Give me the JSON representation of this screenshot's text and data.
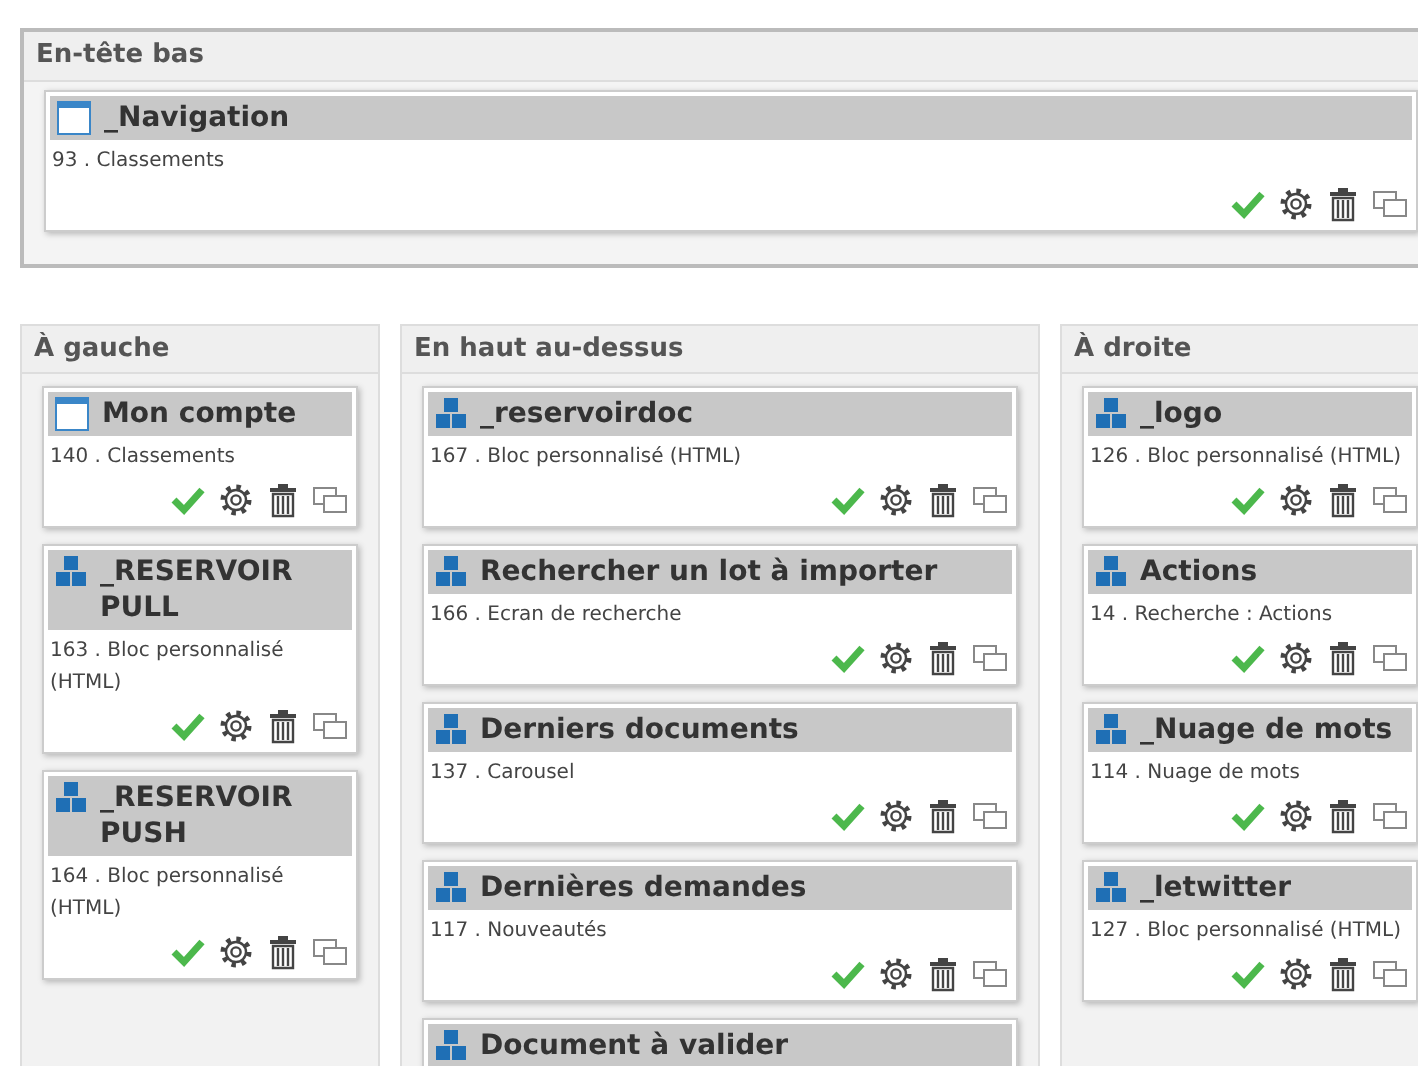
{
  "header_section": {
    "title": "En-tête bas",
    "blocks": [
      {
        "kind": "page",
        "title": "_Navigation",
        "description": "93 . Classements"
      }
    ]
  },
  "columns": [
    {
      "title": "À gauche",
      "blocks": [
        {
          "kind": "page",
          "title": "Mon compte",
          "description": "140 . Classements"
        },
        {
          "kind": "module",
          "title": "_RESERVOIR PULL",
          "description": "163 . Bloc personnalisé (HTML)"
        },
        {
          "kind": "module",
          "title": "_RESERVOIR PUSH",
          "description": "164 . Bloc personnalisé (HTML)"
        }
      ]
    },
    {
      "title": "En haut au-dessus",
      "blocks": [
        {
          "kind": "module",
          "title": "_reservoirdoc",
          "description": "167 . Bloc personnalisé (HTML)"
        },
        {
          "kind": "module",
          "title": "Rechercher un lot à importer",
          "description": "166 . Ecran de recherche"
        },
        {
          "kind": "module",
          "title": "Derniers documents",
          "description": "137 . Carousel"
        },
        {
          "kind": "module",
          "title": "Dernières demandes",
          "description": "117 . Nouveautés"
        },
        {
          "kind": "module",
          "title": "Document à valider"
        }
      ]
    },
    {
      "title": "À droite",
      "blocks": [
        {
          "kind": "module",
          "title": "_logo",
          "description": "126 . Bloc personnalisé (HTML)"
        },
        {
          "kind": "module",
          "title": "Actions",
          "description": "14 . Recherche : Actions"
        },
        {
          "kind": "module",
          "title": "_Nuage de mots",
          "description": "114 . Nuage de mots"
        },
        {
          "kind": "module",
          "title": "_letwitter",
          "description": "127 . Bloc personnalisé (HTML)"
        }
      ]
    }
  ]
}
